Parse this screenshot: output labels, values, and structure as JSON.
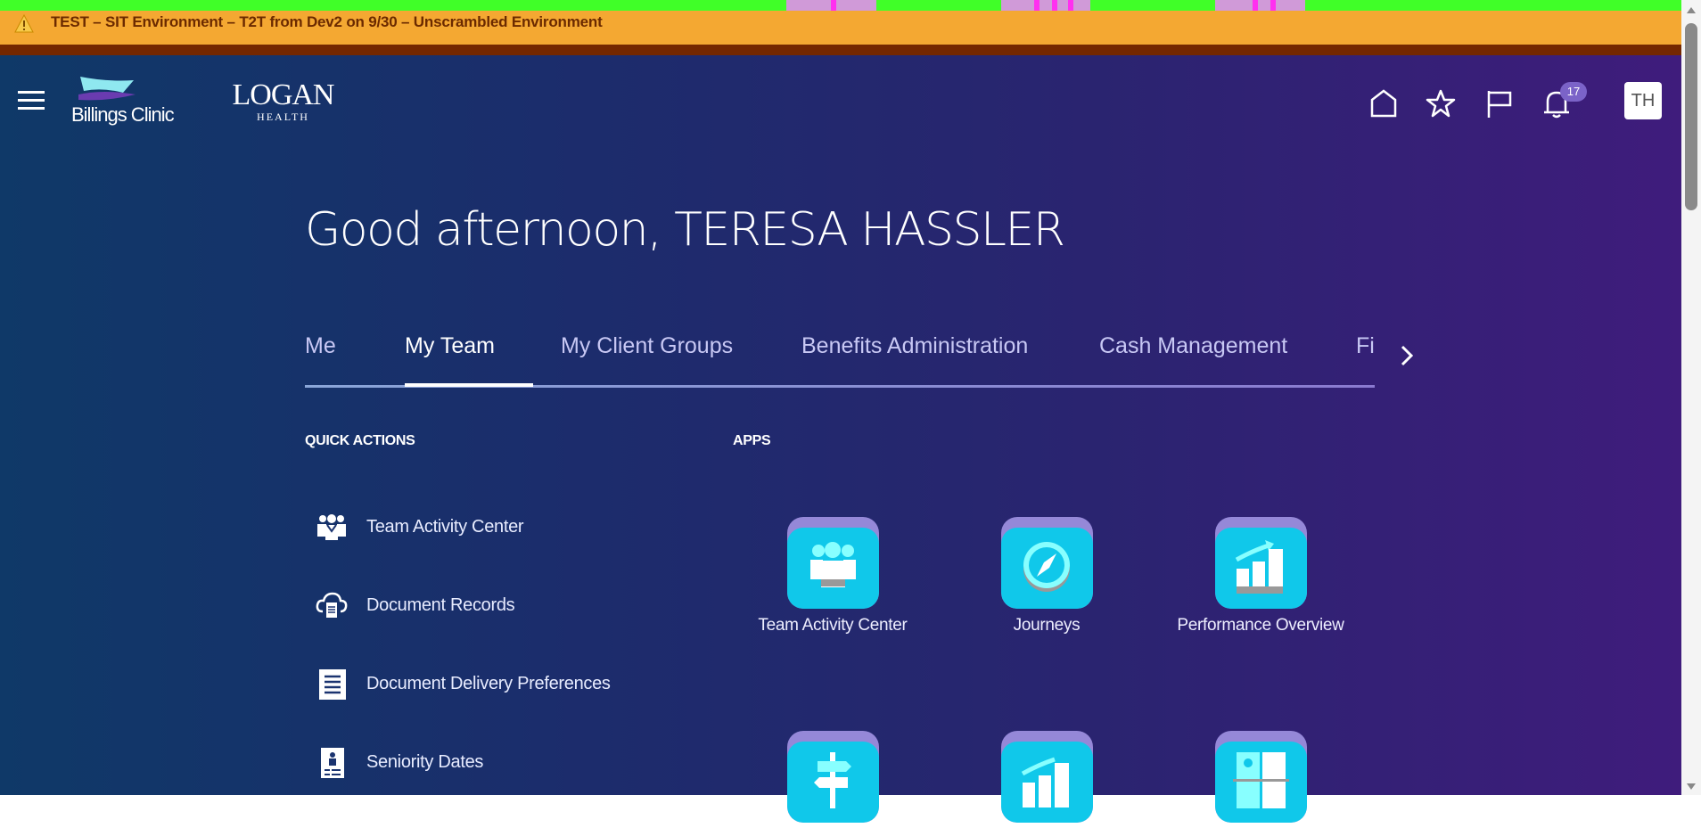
{
  "banner": {
    "text": "TEST – SIT Environment – T2T from Dev2 on 9/30 – Unscrambled Environment",
    "icon": "warning-icon"
  },
  "header": {
    "logos": {
      "billings": "Billings Clinic",
      "logan": "LOGAN",
      "logan_sub": "HEALTH"
    },
    "notification_count": "17",
    "avatar_initials": "TH"
  },
  "greeting": "Good afternoon, TERESA HASSLER",
  "tabs": [
    {
      "label": "Me"
    },
    {
      "label": "My Team",
      "active": true
    },
    {
      "label": "My Client Groups"
    },
    {
      "label": "Benefits Administration"
    },
    {
      "label": "Cash Management"
    },
    {
      "label": "Fixed Assets"
    }
  ],
  "quick_actions": {
    "title": "QUICK ACTIONS",
    "items": [
      {
        "label": "Team Activity Center"
      },
      {
        "label": "Document Records"
      },
      {
        "label": "Document Delivery Preferences"
      },
      {
        "label": "Seniority Dates"
      }
    ]
  },
  "apps": {
    "title": "APPS",
    "items": [
      {
        "label": "Team Activity Center"
      },
      {
        "label": "Journeys"
      },
      {
        "label": "Performance Overview"
      },
      {
        "label": ""
      },
      {
        "label": ""
      },
      {
        "label": ""
      }
    ]
  },
  "colors": {
    "banner": "#f4a832",
    "tile": "#10c8ea",
    "tile_top": "#9588d8"
  }
}
